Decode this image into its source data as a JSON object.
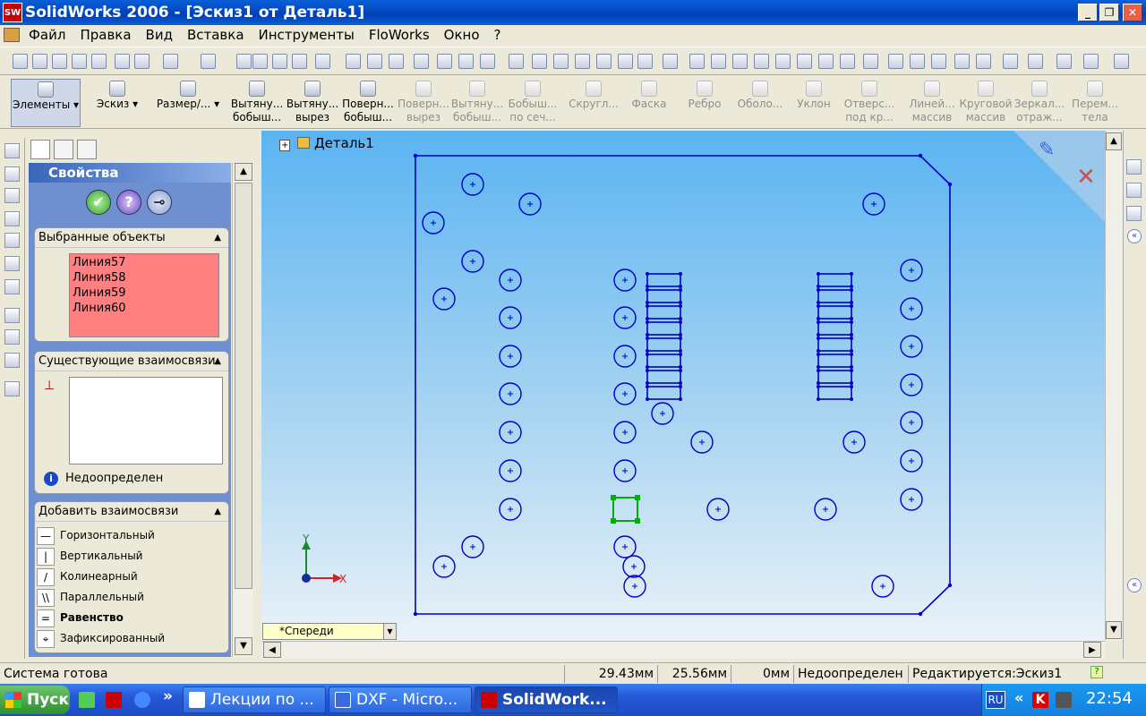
{
  "window": {
    "title": "SolidWorks 2006 - [Эскиз1 от Деталь1]",
    "app_icon": "SW"
  },
  "menu": [
    "Файл",
    "Правка",
    "Вид",
    "Вставка",
    "Инструменты",
    "FloWorks",
    "Окно",
    "?"
  ],
  "feature_toolbar": {
    "elements": "Элементы",
    "sketch": "Эскиз",
    "dimension": "Размер/...",
    "commands": [
      {
        "line1": "Вытяну...",
        "line2": "бобыш..."
      },
      {
        "line1": "Вытяну...",
        "line2": "вырез"
      },
      {
        "line1": "Поверн...",
        "line2": "бобыш..."
      },
      {
        "line1": "Поверн...",
        "line2": "вырез"
      },
      {
        "line1": "Вытяну...",
        "line2": "бобыш..."
      },
      {
        "line1": "Бобыш...",
        "line2": "по сеч..."
      },
      {
        "line1": "Скругл...",
        "line2": ""
      },
      {
        "line1": "Фаска",
        "line2": ""
      },
      {
        "line1": "Ребро",
        "line2": ""
      },
      {
        "line1": "Оболо...",
        "line2": ""
      },
      {
        "line1": "Уклон",
        "line2": ""
      },
      {
        "line1": "Отверс...",
        "line2": "под кр..."
      },
      {
        "line1": "Линей...",
        "line2": "массив"
      },
      {
        "line1": "Круговой",
        "line2": "массив"
      },
      {
        "line1": "Зеркал...",
        "line2": "отраж..."
      },
      {
        "line1": "Перем...",
        "line2": "тела"
      }
    ]
  },
  "property_manager": {
    "title": "Свойства",
    "selected_header": "Выбранные объекты",
    "selected_items": [
      "Линия57",
      "Линия58",
      "Линия59",
      "Линия60"
    ],
    "existing_header": "Существующие взаимосвязи",
    "status": "Недоопределен",
    "add_header": "Добавить взаимосвязи",
    "relations": [
      {
        "icon": "—",
        "label": "Горизонтальный"
      },
      {
        "icon": "|",
        "label": "Вертикальный"
      },
      {
        "icon": "/",
        "label": "Колинеарный"
      },
      {
        "icon": "\\\\",
        "label": "Параллельный"
      },
      {
        "icon": "=",
        "label": "Равенство"
      },
      {
        "icon": "⌖",
        "label": "Зафиксированный"
      }
    ]
  },
  "graphics": {
    "tree_label": "Деталь1",
    "view_name": "*Спереди",
    "triad": {
      "y": "Y",
      "x": "X"
    }
  },
  "status_bar": {
    "message": "Система готова",
    "x": "29.43мм",
    "y": "25.56мм",
    "z": "0мм",
    "state": "Недоопределен",
    "editing": "Редактируется:Эскиз1",
    "help": "?"
  },
  "taskbar": {
    "start": "Пуск",
    "overflow": "»",
    "buttons": [
      {
        "label": "Лекции по ..."
      },
      {
        "label": "DXF - Micro..."
      },
      {
        "label": "SolidWork..."
      }
    ],
    "tray": {
      "lang": "RU",
      "chevron": "«",
      "clock": "22:54"
    }
  },
  "colors": {
    "sketch": "#0000c8",
    "selected": "#00b000",
    "title_bar": "#0a5fd8",
    "selection_list": "#ff8080"
  }
}
